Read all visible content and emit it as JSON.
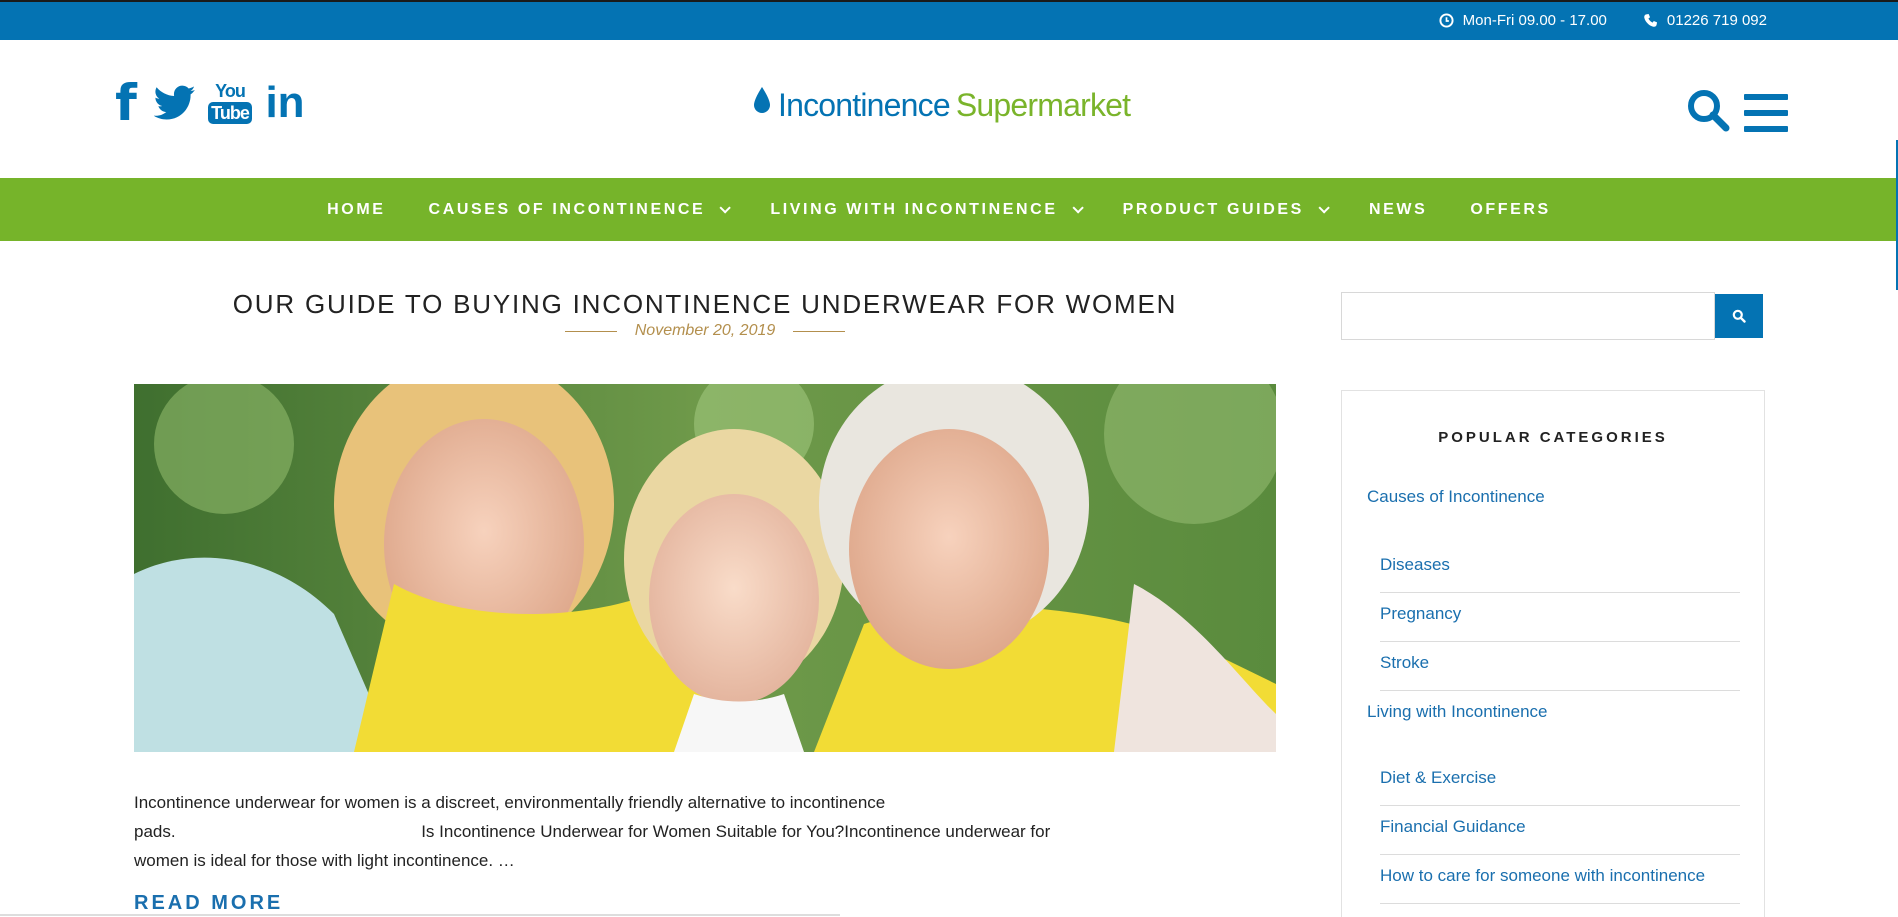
{
  "topbar": {
    "hours": "Mon-Fri 09.00 - 17.00",
    "phone": "01226 719 092",
    "bg_color": "#0473b3"
  },
  "header": {
    "social_icons": [
      "facebook-icon",
      "twitter-icon",
      "youtube-icon",
      "linkedin-icon"
    ],
    "youtube_you": "You",
    "youtube_tube": "Tube",
    "linkedin_text": "in",
    "facebook_text": "f",
    "logo_part1": "Incontinence",
    "logo_part2": "Supermarket",
    "brand_blue": "#0473b3",
    "brand_green": "#7ab42b"
  },
  "nav": {
    "bg_color": "#76b42a",
    "items": [
      {
        "label": "HOME",
        "dropdown": false
      },
      {
        "label": "CAUSES OF INCONTINENCE",
        "dropdown": true
      },
      {
        "label": "LIVING WITH INCONTINENCE",
        "dropdown": true
      },
      {
        "label": "PRODUCT GUIDES",
        "dropdown": true
      },
      {
        "label": "NEWS",
        "dropdown": false
      },
      {
        "label": "OFFERS",
        "dropdown": false
      }
    ]
  },
  "article": {
    "title": "OUR GUIDE TO BUYING INCONTINENCE UNDERWEAR FOR WOMEN",
    "date": "November 20, 2019",
    "excerpt_line1": "Incontinence underwear for women is a discreet, environmentally friendly alternative to incontinence",
    "excerpt_line2": "pads.                                                    Is Incontinence Underwear for Women Suitable for You?Incontinence underwear for",
    "excerpt_line3": "women is ideal for those with light incontinence. …",
    "read_more": "READ MORE"
  },
  "sidebar": {
    "search_placeholder": "",
    "popular_title": "POPULAR CATEGORIES",
    "categories": [
      {
        "label": "Causes of Incontinence",
        "children": [
          "Diseases",
          "Pregnancy",
          "Stroke"
        ]
      },
      {
        "label": "Living with Incontinence",
        "children": [
          "Diet & Exercise",
          "Financial Guidance",
          "How to care for someone with incontinence"
        ]
      }
    ]
  }
}
